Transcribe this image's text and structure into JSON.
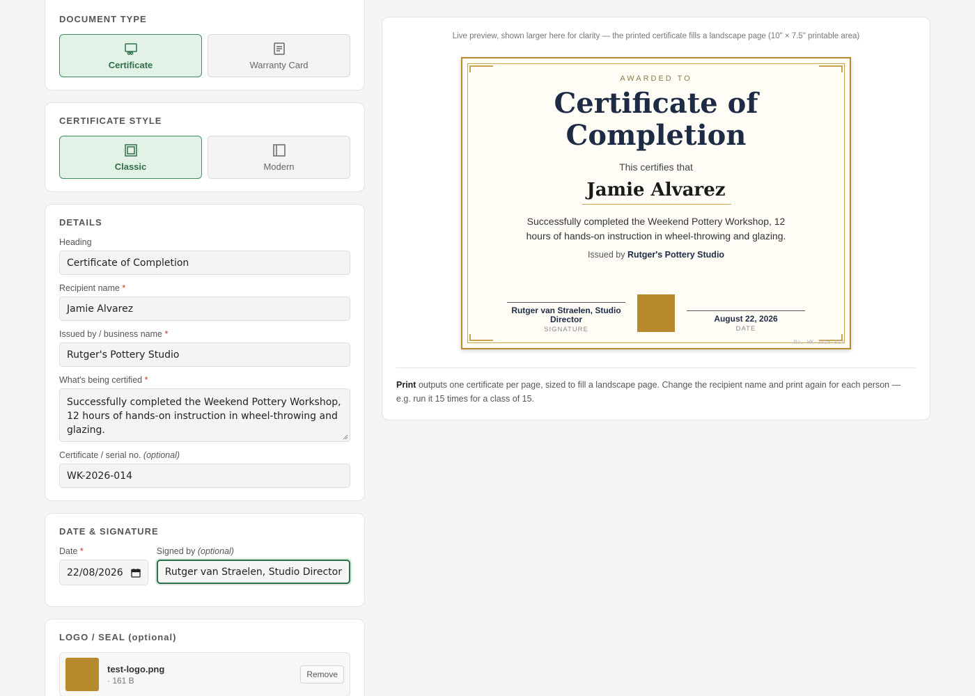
{
  "document_type": {
    "title": "DOCUMENT TYPE",
    "options": [
      {
        "label": "Certificate",
        "icon": "certificate-icon",
        "active": true
      },
      {
        "label": "Warranty Card",
        "icon": "document-icon",
        "active": false
      }
    ]
  },
  "certificate_style": {
    "title": "CERTIFICATE STYLE",
    "options": [
      {
        "label": "Classic",
        "icon": "frame-icon",
        "active": true
      },
      {
        "label": "Modern",
        "icon": "panel-icon",
        "active": false
      }
    ]
  },
  "details": {
    "title": "DETAILS",
    "heading_label": "Heading",
    "heading_value": "Certificate of Completion",
    "recipient_label": "Recipient name",
    "recipient_value": "Jamie Alvarez",
    "issuer_label": "Issued by / business name",
    "issuer_value": "Rutger's Pottery Studio",
    "certified_label": "What's being certified",
    "certified_value": "Successfully completed the Weekend Pottery Workshop, 12 hours of hands-on instruction in wheel-throwing and glazing.",
    "serial_label": "Certificate / serial no.",
    "serial_optional": "(optional)",
    "serial_value": "WK-2026-014",
    "required_mark": "*"
  },
  "date_signature": {
    "title": "DATE & SIGNATURE",
    "date_label": "Date",
    "date_value": "22/08/2026",
    "signed_label": "Signed by",
    "signed_optional": "(optional)",
    "signed_value": "Rutger van Straelen, Studio Director"
  },
  "logo": {
    "title": "LOGO / SEAL",
    "title_optional": "(optional)",
    "file_name": "test-logo.png",
    "file_size": "· 161 B",
    "remove_label": "Remove",
    "color": "#b78a2e"
  },
  "preview": {
    "note": "Live preview, shown larger here for clarity — the printed certificate fills a landscape page (10\" × 7.5\" printable area)",
    "awarded_to": "AWARDED TO",
    "heading": "Certificate of Completion",
    "certifies": "This certifies that",
    "recipient": "Jamie Alvarez",
    "description": "Successfully completed the Weekend Pottery Workshop, 12 hours of hands-on instruction in wheel-throwing and glazing.",
    "issued_prefix": "Issued by",
    "issuer": "Rutger's Pottery Studio",
    "signature_name": "Rutger van Straelen, Studio Director",
    "signature_caption": "SIGNATURE",
    "date_text": "August 22, 2026",
    "date_caption": "DATE",
    "serial_text": "No. WK-2026-014"
  },
  "help": {
    "bold": "Print",
    "text": " outputs one certificate per page, sized to fill a landscape page. Change the recipient name and print again for each person — e.g. run it 15 times for a class of 15."
  },
  "colors": {
    "accent_green": "#2f6f49",
    "gold": "#b78a2e",
    "navy": "#1e2b45"
  }
}
